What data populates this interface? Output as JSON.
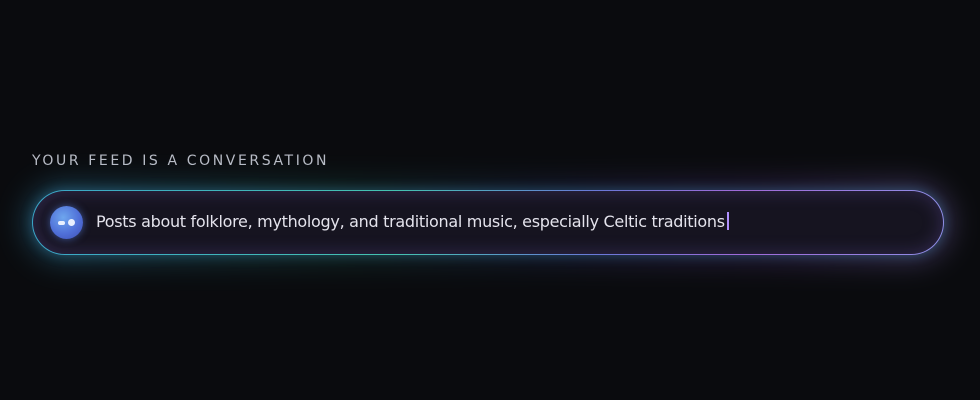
{
  "feed": {
    "label": "YOUR FEED IS A CONVERSATION",
    "input_value": "Posts about folklore, mythology, and traditional music, especially Celtic traditions",
    "avatar_icon": "bot-face-icon"
  },
  "colors": {
    "background": "#0a0b0e",
    "pill_fill": "#161420",
    "border_start": "#3ba6c8",
    "border_end": "#a16ad8",
    "avatar": "#5070d8",
    "caret": "#b090ff"
  }
}
